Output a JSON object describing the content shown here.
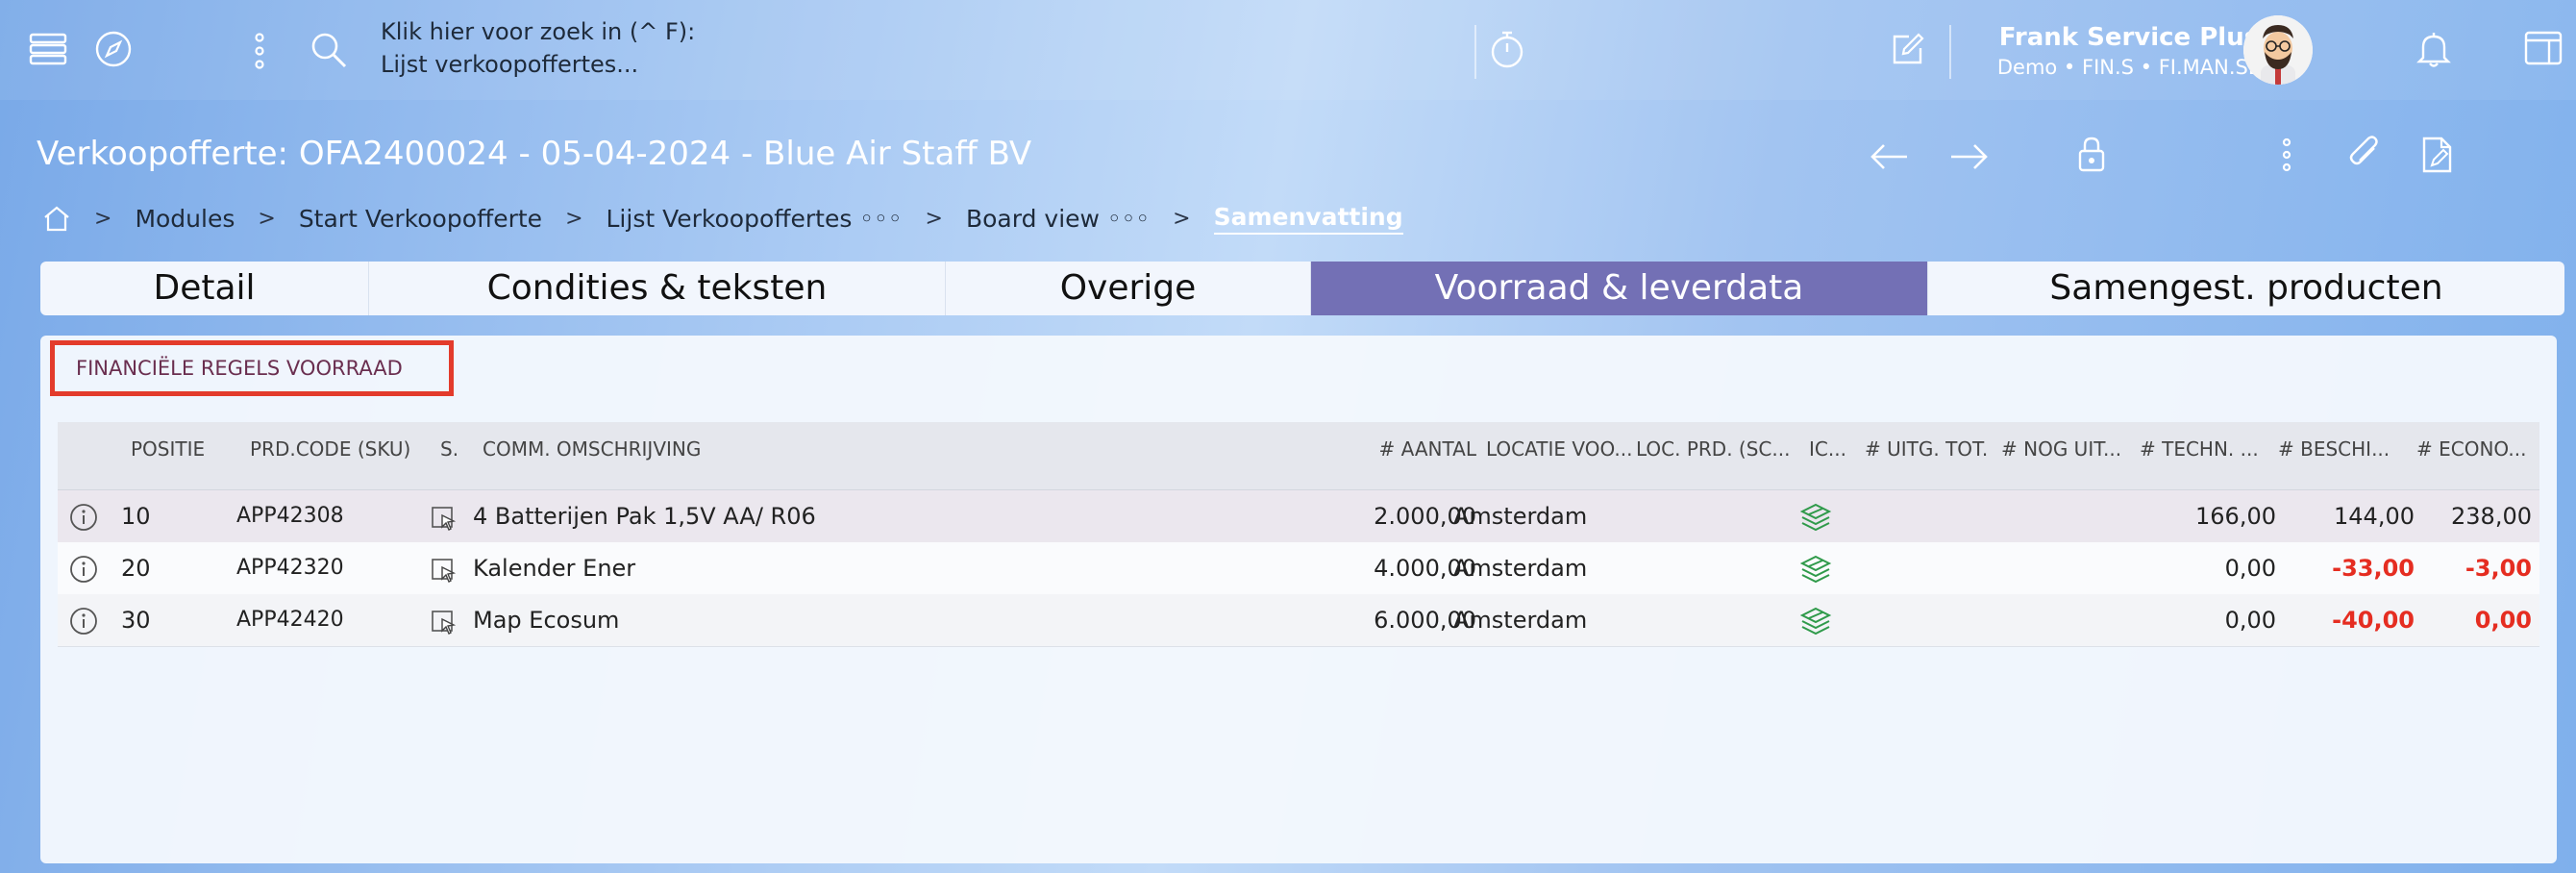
{
  "topbar": {
    "search_line1": "Klik hier voor zoek in (^ F):",
    "search_line2": "Lijst verkoopoffertes...",
    "user_name": "Frank Service Plus",
    "user_sub": "Demo • FIN.S • FI.MAN.SE",
    "icons": [
      "menu-icon",
      "compass-icon",
      "more-vertical-icon",
      "search-icon",
      "stopwatch-icon",
      "edit-icon",
      "bell-icon",
      "sidebar-panel-icon"
    ]
  },
  "header": {
    "title": "Verkoopofferte: OFA2400024 - 05-04-2024 - Blue Air Staff BV",
    "breadcrumb": [
      "Modules",
      "Start Verkoopofferte",
      "Lijst Verkoopoffertes ◦◦◦",
      "Board view ◦◦◦",
      "Samenvatting"
    ]
  },
  "tabs": [
    "Detail",
    "Condities & teksten",
    "Overige",
    "Voorraad & leverdata",
    "Samengest. producten"
  ],
  "active_tab": "Voorraad & leverdata",
  "section": {
    "title": "FINANCIËLE REGELS VOORRAAD"
  },
  "table": {
    "headers": [
      "POSITIE",
      "PRD.CODE (SKU)",
      "S.",
      "COMM. OMSCHRIJVING",
      "# AANTAL",
      "LOCATIE VOO...",
      "LOC. PRD. (SC...",
      "IC...",
      "# UITG. TOT.",
      "# NOG UIT...",
      "# TECHN. ...",
      "# BESCHI...",
      "# ECONO..."
    ],
    "rows": [
      {
        "positie": "10",
        "sku": "APP42308",
        "omschrijving": "4 Batterijen Pak 1,5V AA/ R06",
        "aantal": "2.000,00",
        "locatie": "Amsterdam",
        "techn": "166,00",
        "beschi": "144,00",
        "econo": "238,00",
        "beschi_neg": false,
        "econo_neg": false
      },
      {
        "positie": "20",
        "sku": "APP42320",
        "omschrijving": "Kalender Ener",
        "aantal": "4.000,00",
        "locatie": "Amsterdam",
        "techn": "0,00",
        "beschi": "-33,00",
        "econo": "-3,00",
        "beschi_neg": true,
        "econo_neg": true
      },
      {
        "positie": "30",
        "sku": "APP42420",
        "omschrijving": "Map Ecosum",
        "aantal": "6.000,00",
        "locatie": "Amsterdam",
        "techn": "0,00",
        "beschi": "-40,00",
        "econo": "0,00",
        "beschi_neg": true,
        "econo_neg": true
      }
    ]
  },
  "colors": {
    "active_tab": "#7370b5",
    "negative": "#e52d21",
    "highlight": "#e33b2b",
    "stock_icon": "#2f9a4a"
  }
}
